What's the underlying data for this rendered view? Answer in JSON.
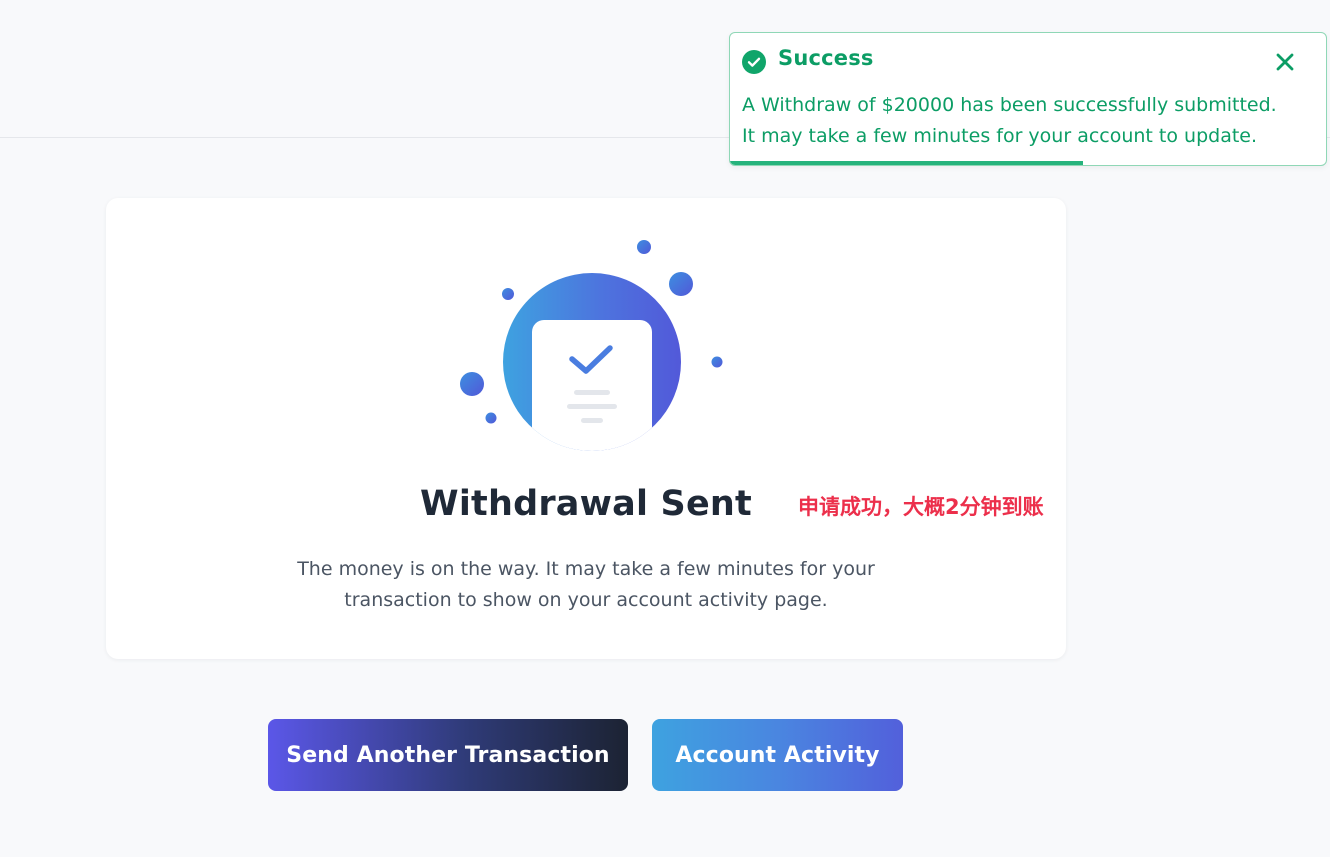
{
  "toast": {
    "title": "Success",
    "line1": "A Withdraw of $20000 has been successfully submitted.",
    "line2": "It may take a few minutes for your account to update.",
    "progress_fraction": 0.593,
    "color": "#0c9d65",
    "icons": {
      "status": "check-circle-icon",
      "close": "close-icon"
    }
  },
  "card": {
    "title": "Withdrawal Sent",
    "subtitle": "The money is on the way. It may take a few minutes for your transaction to show on your account activity page.",
    "illustration_icon": "document-check-icon"
  },
  "annotation": {
    "text": "申请成功，大概2分钟到账",
    "color": "#ec2f4b"
  },
  "actions": {
    "send_another_label": "Send Another Transaction",
    "account_activity_label": "Account Activity"
  },
  "colors": {
    "brand_gradient_start": "#3ea2e0",
    "brand_gradient_end": "#5260db",
    "dark_button_end": "#1c2333"
  }
}
